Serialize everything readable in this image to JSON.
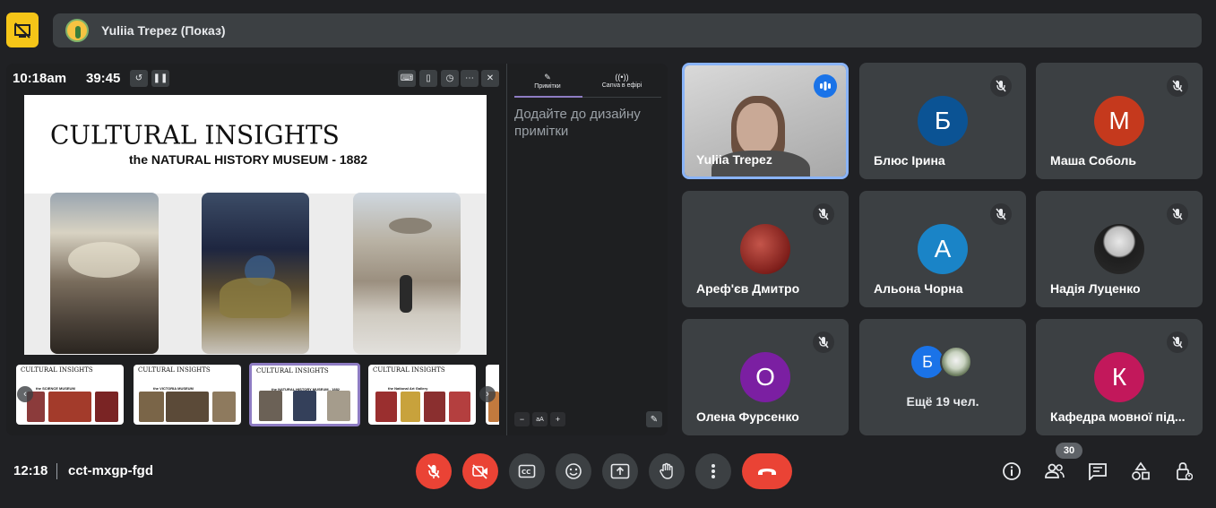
{
  "top": {
    "presenter_label": "Yuliia Trepez (Показ)"
  },
  "presenter_view": {
    "clock": "10:18am",
    "timer": "39:45",
    "slide": {
      "title": "CULTURAL INSIGHTS",
      "subtitle": "the NATURAL HISTORY MUSEUM - 1882"
    },
    "thumbnails": [
      {
        "title": "CULTURAL INSIGHTS",
        "subtitle": "the SCIENCE MUSEUM"
      },
      {
        "title": "CULTURAL INSIGHTS",
        "subtitle": "the VICTORIA MUSEUM"
      },
      {
        "title": "CULTURAL INSIGHTS",
        "subtitle": "the NATURAL HISTORY MUSEUM - 1882"
      },
      {
        "title": "CULTURAL INSIGHTS",
        "subtitle": "the National Art Gallery"
      }
    ]
  },
  "notes": {
    "tab_notes": "Примітки",
    "tab_live": "Canva в ефірі",
    "placeholder": "Додайте до дизайну примітки",
    "zoom_label": "aA"
  },
  "participants": [
    {
      "name": "Yuliia Trepez",
      "type": "video",
      "speaking": true
    },
    {
      "name": "Блюс Ірина",
      "initial": "Б",
      "color": "#0b5394",
      "muted": true
    },
    {
      "name": "Маша Соболь",
      "initial": "М",
      "color": "#c5391d",
      "muted": true
    },
    {
      "name": "Ареф'єв Дмитро",
      "type": "photo-red",
      "muted": true
    },
    {
      "name": "Альона Чорна",
      "initial": "А",
      "color": "#1a84c7",
      "muted": true
    },
    {
      "name": "Надія Луценко",
      "type": "photo-gray",
      "muted": true
    },
    {
      "name": "Олена Фурсенко",
      "initial": "О",
      "color": "#7b1fa2",
      "muted": true
    },
    {
      "more_label": "Ещё 19 чел.",
      "initial": "Б",
      "color": "#1a73e8"
    },
    {
      "name": "Кафедра мовної під...",
      "initial": "К",
      "color": "#c2185b",
      "muted": true
    }
  ],
  "bottom": {
    "time": "12:18",
    "meeting_code": "cct-mxgp-fgd",
    "participant_count": "30"
  }
}
